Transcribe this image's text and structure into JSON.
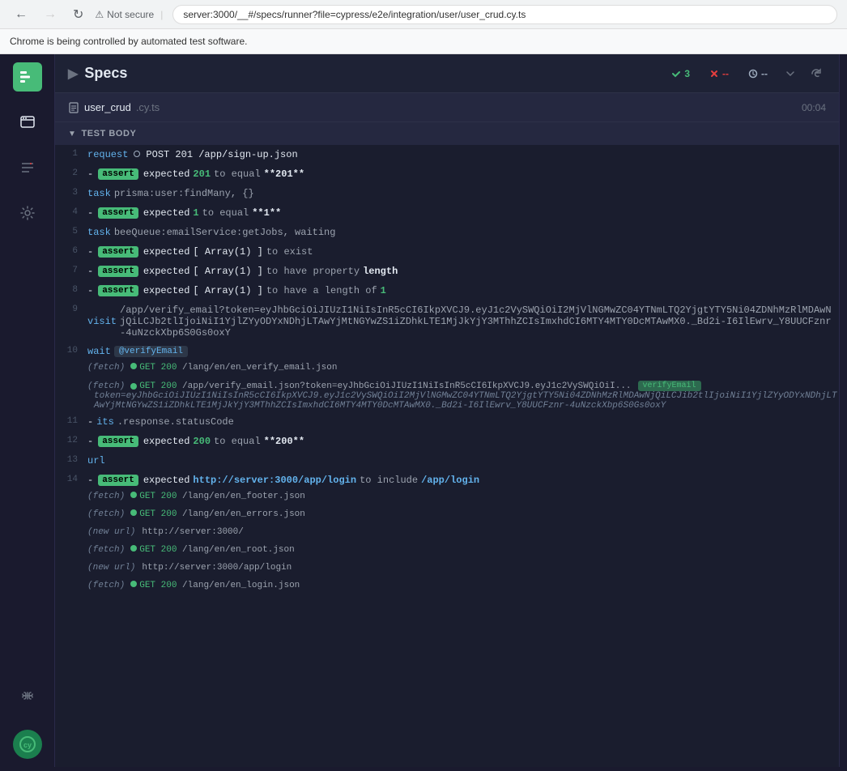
{
  "browser": {
    "back_btn": "←",
    "forward_btn": "→",
    "refresh_btn": "↺",
    "security_text": "Not secure",
    "url": "server:3000/__#/specs/runner?file=cypress/e2e/integration/user/user_crud.cy.ts",
    "info_bar": "Chrome is being controlled by automated test software."
  },
  "header": {
    "specs_label": "Specs",
    "pass_count": "3",
    "fail_count": "--",
    "pending_count": "--"
  },
  "file": {
    "name": "user_crud",
    "ext": ".cy.ts",
    "time": "00:04"
  },
  "section": {
    "label": "TEST BODY"
  },
  "sidebar": {
    "logo": "■■",
    "icons": [
      "◫",
      "☰",
      "⚙"
    ],
    "bottom_icons": [
      "⌘"
    ],
    "cy_label": "cy"
  }
}
